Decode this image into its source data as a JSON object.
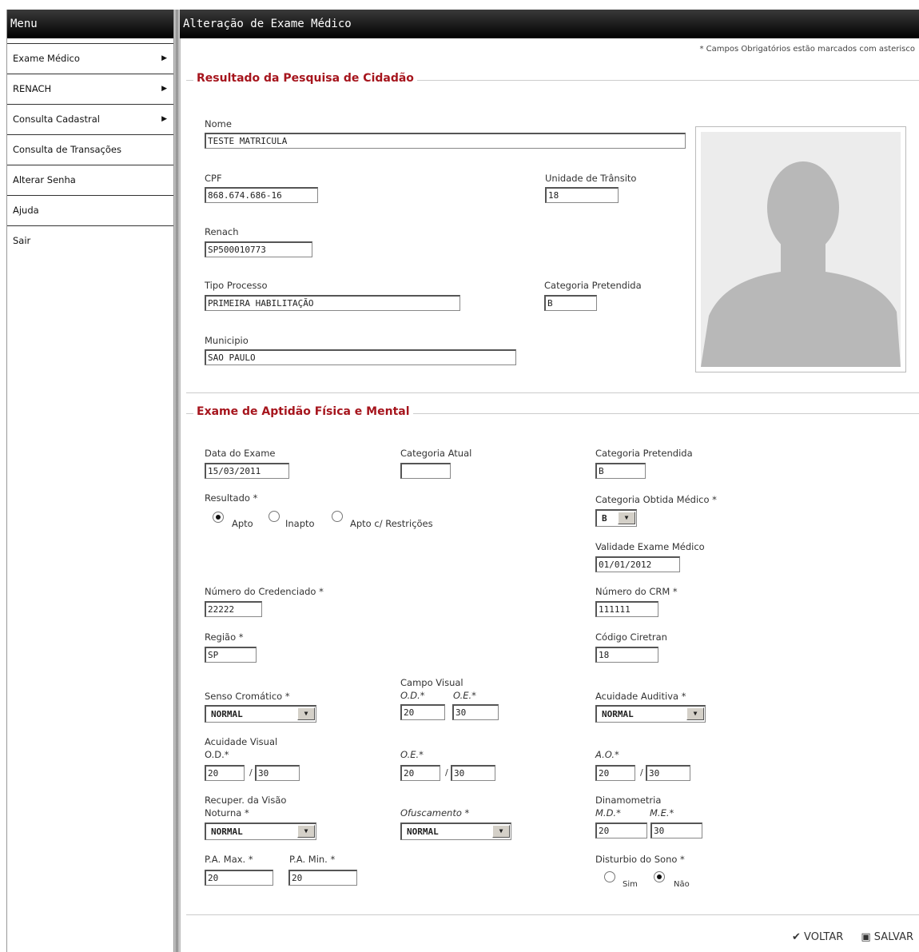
{
  "sidebar": {
    "title": "Menu",
    "items": [
      {
        "label": "Exame Médico",
        "arrow": "▶"
      },
      {
        "label": "RENACH",
        "arrow": "▶"
      },
      {
        "label": "Consulta Cadastral",
        "arrow": "▶"
      },
      {
        "label": "Consulta de Transações"
      },
      {
        "label": "Alterar Senha"
      },
      {
        "label": "Ajuda"
      },
      {
        "label": "Sair"
      }
    ]
  },
  "header": {
    "title": "Alteração de Exame Médico"
  },
  "required_note": "* Campos Obrigatórios estão marcados com asterisco",
  "pesquisa": {
    "legend": "Resultado da Pesquisa de Cidadão",
    "nome": {
      "label": "Nome",
      "value": "TESTE MATRICULA"
    },
    "cpf": {
      "label": "CPF",
      "value": "868.674.686-16"
    },
    "unidade": {
      "label": "Unidade de Trânsito",
      "value": "18"
    },
    "renach": {
      "label": "Renach",
      "value": "SP500010773"
    },
    "tipo": {
      "label": "Tipo Processo",
      "value": "PRIMEIRA HABILITAÇÃO"
    },
    "categoria": {
      "label": "Categoria Pretendida",
      "value": "B"
    },
    "municipio": {
      "label": "Municipio",
      "value": "SAO PAULO"
    }
  },
  "exame": {
    "legend": "Exame de Aptidão Física e Mental",
    "data_exame": {
      "label": "Data do Exame",
      "value": "15/03/2011"
    },
    "cat_atual": {
      "label": "Categoria Atual",
      "value": ""
    },
    "cat_pretendida": {
      "label": "Categoria Pretendida",
      "value": "B"
    },
    "resultado": {
      "label": "Resultado *",
      "options": [
        "Apto",
        "Inapto",
        "Apto c/ Restrições"
      ]
    },
    "cat_obtida": {
      "label": "Categoria Obtida Médico *",
      "value": "B"
    },
    "validade": {
      "label": "Validade Exame Médico",
      "value": "01/01/2012"
    },
    "num_cred": {
      "label": "Número do Credenciado *",
      "value": "22222"
    },
    "num_crm": {
      "label": "Número do CRM *",
      "value": "111111"
    },
    "regiao": {
      "label": "Região *",
      "value": "SP"
    },
    "cod_ciretran": {
      "label": "Código Ciretran",
      "value": "18"
    },
    "senso": {
      "label": "Senso Cromático *",
      "value": "NORMAL"
    },
    "campo_visual": {
      "label": "Campo Visual",
      "od_label": "O.D.*",
      "oe_label": "O.E.*",
      "od": "20",
      "oe": "30"
    },
    "acuidade_auditiva": {
      "label": "Acuidade Auditiva *",
      "value": "NORMAL"
    },
    "acuidade_visual": {
      "label": "Acuidade Visual",
      "od_label": "O.D.*",
      "oe_label": "O.E.*",
      "ao_label": "A.O.*",
      "od1": "20",
      "od2": "30",
      "oe1": "20",
      "oe2": "30",
      "ao1": "20",
      "ao2": "30"
    },
    "recuper": {
      "label1": "Recuper. da Visão",
      "label2": "Noturna *",
      "value": "NORMAL"
    },
    "ofuscamento": {
      "label": "Ofuscamento *",
      "value": "NORMAL"
    },
    "dinamometria": {
      "label": "Dinamometria",
      "md_label": "M.D.*",
      "me_label": "M.E.*",
      "md": "20",
      "me": "30"
    },
    "pa_max": {
      "label": "P.A. Max. *",
      "value": "20"
    },
    "pa_min": {
      "label": "P.A. Min. *",
      "value": "20"
    },
    "disturbio": {
      "label": "Disturbio do Sono *",
      "options": [
        "Sim",
        "Não"
      ]
    }
  },
  "actions": {
    "voltar": "✔ VOLTAR",
    "salvar": "▣ SALVAR"
  }
}
